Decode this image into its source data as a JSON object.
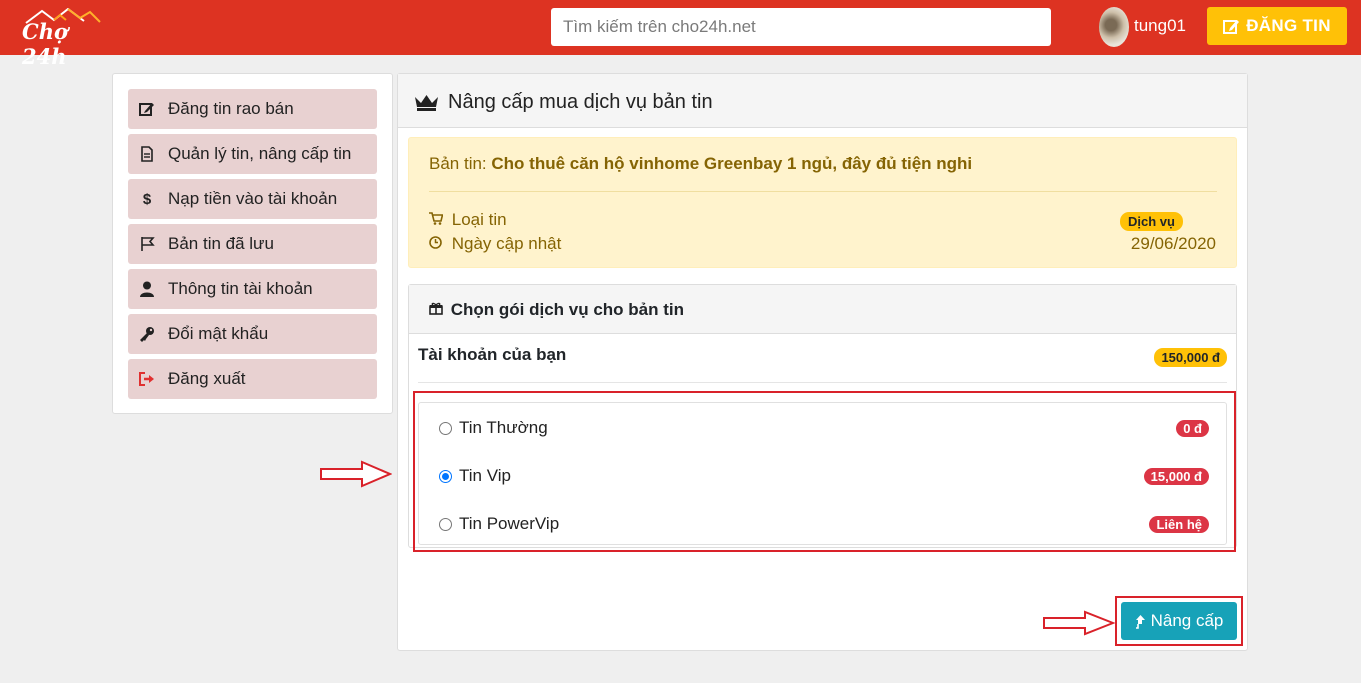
{
  "header": {
    "logo_text": "Chợ 24h",
    "search_placeholder": "Tìm kiếm trên cho24h.net",
    "username": "tung01",
    "post_button": "ĐĂNG TIN"
  },
  "sidebar": {
    "items": [
      {
        "label": "Đăng tin rao bán",
        "icon": "edit-icon"
      },
      {
        "label": "Quản lý tin, nâng cấp tin",
        "icon": "document-icon"
      },
      {
        "label": "Nạp tiền vào tài khoản",
        "icon": "dollar-icon"
      },
      {
        "label": "Bản tin đã lưu",
        "icon": "flag-icon"
      },
      {
        "label": "Thông tin tài khoản",
        "icon": "user-icon"
      },
      {
        "label": "Đổi mật khẩu",
        "icon": "key-icon"
      },
      {
        "label": "Đăng xuất",
        "icon": "sign-out-icon"
      }
    ]
  },
  "main": {
    "title": "Nâng cấp mua dịch vụ bản tin",
    "listing_prefix": "Bản tin:",
    "listing_title": "Cho thuê căn hộ vinhome Greenbay 1 ngủ, đây đủ tiện nghi",
    "type_label": "Loại tin",
    "updated_label": "Ngày cập nhật",
    "type_badge": "Dịch vụ",
    "updated_date": "29/06/2020",
    "package_title": "Chọn gói dịch vụ cho bản tin",
    "account_label": "Tài khoản của bạn",
    "account_balance": "150,000 đ",
    "options": [
      {
        "label": "Tin Thường",
        "price": "0 đ",
        "selected": false
      },
      {
        "label": "Tin Vip",
        "price": "15,000 đ",
        "selected": true
      },
      {
        "label": "Tin PowerVip",
        "price": "Liên hệ",
        "selected": false
      }
    ],
    "upgrade_button": "Nâng cấp"
  },
  "colors": {
    "header_bg": "#dd3322",
    "post_button_bg": "#ffc107",
    "sidebar_item_bg": "#e8d1d1",
    "info_bg": "#fff3cd",
    "price_badge": "#dc3545",
    "upgrade_button_bg": "#17a2b8",
    "annotation_red": "#d9222a"
  }
}
